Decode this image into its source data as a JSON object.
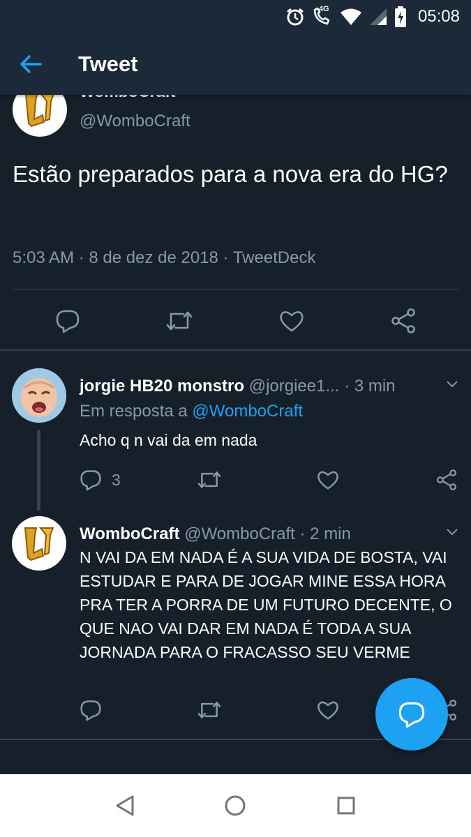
{
  "status_bar": {
    "time": "05:08",
    "network_label": "4G",
    "icons": [
      "alarm-icon",
      "call-4g-icon",
      "wifi-icon",
      "signal-icon",
      "battery-charging-icon"
    ]
  },
  "app_bar": {
    "back_icon": "arrow-left-icon",
    "title": "Tweet"
  },
  "main_tweet": {
    "name": "WomboCraft",
    "handle": "@WomboCraft",
    "text": "Estão preparados para a nova era do HG?",
    "meta": "5:03 AM · 8 de dez de 2018 · TweetDeck",
    "actions": [
      "reply-icon",
      "retweet-icon",
      "like-icon",
      "share-icon"
    ]
  },
  "replies": [
    {
      "name": "jorgie HB20 monstro",
      "handle": "@jorgiee1...",
      "time": "· 3 min",
      "in_reply_prefix": "Em resposta a",
      "in_reply_mention": "@WomboCraft",
      "text": "Acho q n vai da em nada",
      "reply_count": "3"
    },
    {
      "name": "WomboCraft",
      "handle": "@WomboCraft",
      "time": "· 2 min",
      "text": "N VAI DA EM NADA É A SUA VIDA DE BOSTA, VAI ESTUDAR E PARA DE JOGAR MINE ESSA HORA PRA TER A PORRA DE UM FUTURO DECENTE, O QUE NAO VAI DAR EM NADA É TODA A SUA JORNADA PARA O FRACASSO SEU VERME",
      "reply_count": ""
    }
  ],
  "fab": {
    "icon": "compose-reply-icon"
  },
  "nav_bar": {
    "icons": [
      "back-triangle-icon",
      "home-circle-icon",
      "recents-square-icon"
    ]
  },
  "colors": {
    "background": "#15202b",
    "bar": "#1c2938",
    "accent": "#1da1f2",
    "secondary_text": "#8899a6",
    "divider": "#38444d"
  }
}
